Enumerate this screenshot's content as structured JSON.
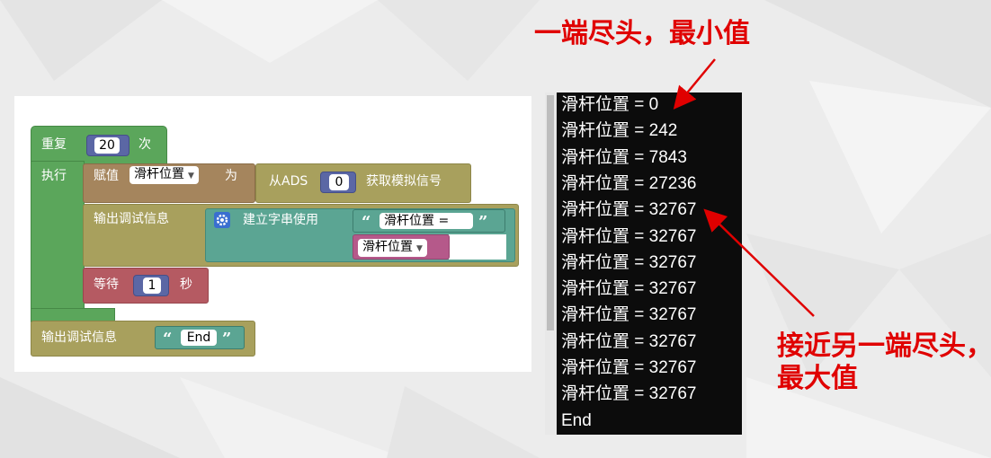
{
  "blocks": {
    "repeat_label": "重复",
    "repeat_count": "20",
    "times_label": "次",
    "do_label": "执行",
    "assign_label": "赋值",
    "var_name": "滑杆位置",
    "as_label": "为",
    "from_ads_label": "从ADS",
    "ads_channel": "0",
    "get_analog_label": "获取模拟信号",
    "print_label": "输出调试信息",
    "create_string_label": "建立字串使用",
    "string_text": "滑杆位置 =",
    "var_name_2": "滑杆位置",
    "wait_label": "等待",
    "wait_seconds": "1",
    "seconds_label": "秒",
    "print_label_2": "输出调试信息",
    "end_text": "End",
    "open_quote": "“",
    "close_quote": "”",
    "dropdown_arrow": "▼",
    "gear_icon": "gear-icon"
  },
  "console": {
    "lines": [
      "滑杆位置 = 0",
      "滑杆位置 = 242",
      "滑杆位置 = 7843",
      "滑杆位置 = 27236",
      "滑杆位置 = 32767",
      "滑杆位置 = 32767",
      "滑杆位置 = 32767",
      "滑杆位置 = 32767",
      "滑杆位置 = 32767",
      "滑杆位置 = 32767",
      "滑杆位置 = 32767",
      "滑杆位置 = 32767",
      "End"
    ]
  },
  "annotations": {
    "min_note": "一端尽头，最小值",
    "max_note_line1": "接近另一端尽头，",
    "max_note_line2": "最大值",
    "color": "#e00000"
  }
}
